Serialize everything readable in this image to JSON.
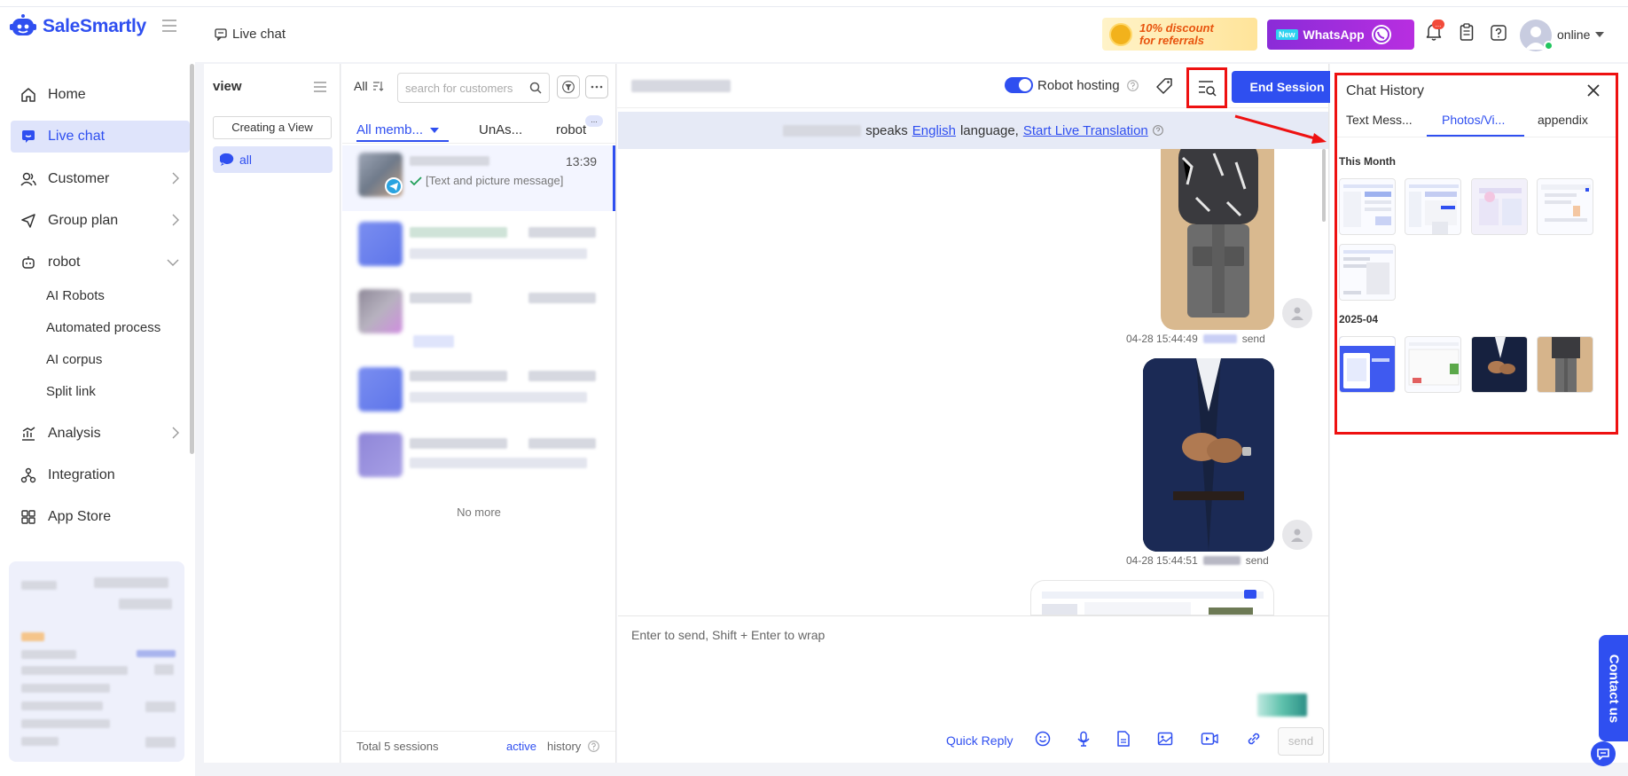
{
  "app": {
    "name": "SaleSmartly"
  },
  "nav": {
    "items": [
      {
        "label": "Home",
        "icon": "home-icon"
      },
      {
        "label": "Live chat",
        "icon": "chat-icon",
        "active": true
      },
      {
        "label": "Customer",
        "icon": "users-icon"
      },
      {
        "label": "Group plan",
        "icon": "send-icon"
      },
      {
        "label": "robot",
        "icon": "robot-icon",
        "expanded": true
      },
      {
        "label": "Analysis",
        "icon": "analytics-icon"
      },
      {
        "label": "Integration",
        "icon": "integration-icon"
      },
      {
        "label": "App Store",
        "icon": "grid-icon"
      }
    ],
    "robot_sub": [
      "AI Robots",
      "Automated process",
      "AI corpus",
      "Split link"
    ]
  },
  "header": {
    "breadcrumb": "Live chat",
    "promo_referral": "10% discount\nfor referrals",
    "promo_whatsapp_new": "New",
    "promo_whatsapp": "WhatsApp",
    "notification_count": "...",
    "status": "online",
    "colors": {
      "accent": "#2f4ff0",
      "online": "#22c55e",
      "alert": "#ee1111"
    }
  },
  "views": {
    "title": "view",
    "create_label": "Creating a View",
    "items": [
      {
        "label": "all",
        "active": true
      }
    ]
  },
  "list": {
    "filter_label": "All",
    "search_placeholder": "search for customers",
    "tabs": [
      "All memb...",
      "UnAs...",
      "robot"
    ],
    "more_badge": "...",
    "active_conversation": {
      "time": "13:39",
      "preview": "[Text and picture message]"
    },
    "no_more": "No more",
    "total": "Total 5 sessions",
    "footer_active": "active",
    "footer_history": "history"
  },
  "chat": {
    "robot_hosting_label": "Robot hosting",
    "robot_hosting_on": true,
    "end_session": "End Session",
    "lang_bar": {
      "speaks": "speaks",
      "language": "English",
      "language_word": "language,",
      "start_translation": "Start Live Translation"
    },
    "messages": [
      {
        "time": "04-28 15:44:49",
        "action": "send"
      },
      {
        "time": "04-28 15:44:51",
        "action": "send"
      }
    ],
    "input_placeholder": "Enter to send, Shift + Enter to wrap",
    "quick_reply": "Quick Reply",
    "send": "send"
  },
  "history": {
    "title": "Chat History",
    "tabs": [
      "Text Mess...",
      "Photos/Vi...",
      "appendix"
    ],
    "active_tab": 1,
    "sections": [
      {
        "label": "This Month",
        "count": 5
      },
      {
        "label": "2025-04",
        "count": 4
      }
    ]
  },
  "contact_us": "Contact us"
}
